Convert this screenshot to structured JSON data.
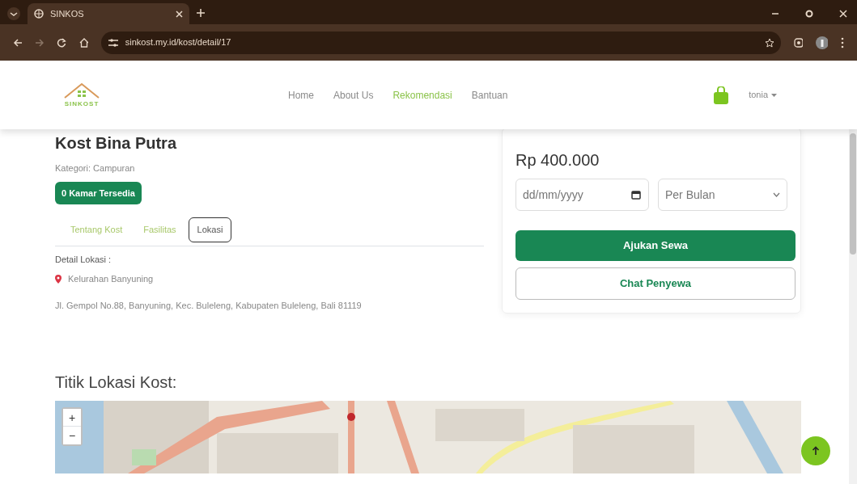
{
  "browser": {
    "tab_title": "SINKOS",
    "url": "sinkost.my.id/kost/detail/17"
  },
  "navbar": {
    "logo_text": "SINKOST",
    "items": [
      {
        "label": "Home",
        "selected": false
      },
      {
        "label": "About Us",
        "selected": false
      },
      {
        "label": "Rekomendasi",
        "selected": true
      },
      {
        "label": "Bantuan",
        "selected": false
      }
    ],
    "user": "tonia"
  },
  "kost": {
    "name": "Kost Bina Putra",
    "category": "Kategori: Campuran",
    "badge": "0 Kamar Tersedia",
    "tabs": [
      {
        "label": "Tentang Kost",
        "selected": false
      },
      {
        "label": "Fasilitas",
        "selected": false
      },
      {
        "label": "Lokasi",
        "selected": true
      }
    ],
    "detail_label": "Detail Lokasi :",
    "kelurahan": "Kelurahan Banyuning",
    "address": "Jl. Gempol No.88, Banyuning, Kec. Buleleng, Kabupaten Buleleng, Bali 81119"
  },
  "booking": {
    "price": "Rp 400.000",
    "date_placeholder": "dd/mm/yyyy",
    "period": "Per Bulan",
    "submit": "Ajukan Sewa",
    "chat": "Chat Penyewa"
  },
  "map": {
    "title": "Titik Lokasi Kost:",
    "zoom_in": "+",
    "zoom_out": "−"
  }
}
